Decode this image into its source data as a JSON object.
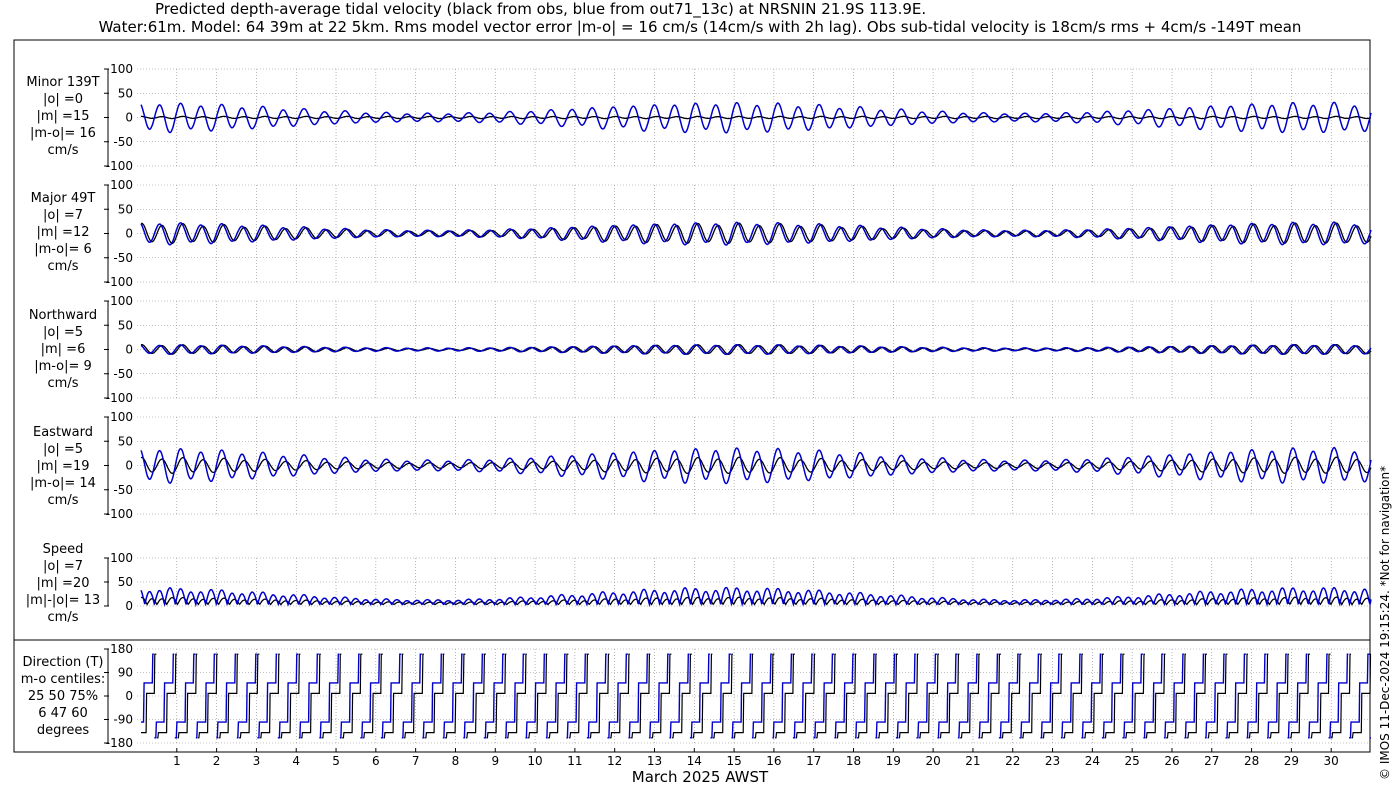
{
  "title_line1": "Predicted depth-average tidal velocity (black from obs, blue from out71_13c) at NRSNIN 21.9S 113.9E.",
  "title_line2": "Water:61m. Model: 64 39m at 22 5km. Rms model vector error |m-o| = 16 cm/s (14cm/s with 2h lag). Obs sub-tidal velocity is 18cm/s rms + 4cm/s -149T mean",
  "xlabel": "March 2025 AWST",
  "copyright": "© IMOS 11-Dec-2024 19:15:24. *Not for navigation*",
  "colors": {
    "obs": "#000000",
    "model": "#0000cc",
    "grid": "#888888"
  },
  "chart_data": {
    "type": "line",
    "x_axis": {
      "range": [
        0,
        31
      ],
      "ticks": [
        1,
        2,
        3,
        4,
        5,
        6,
        7,
        8,
        9,
        10,
        11,
        12,
        13,
        14,
        15,
        16,
        17,
        18,
        19,
        20,
        21,
        22,
        23,
        24,
        25,
        26,
        27,
        28,
        29,
        30
      ]
    },
    "series_legend": [
      "black from obs",
      "blue from out71_13c"
    ],
    "panels": [
      {
        "id": "minor",
        "label_lines": [
          "Minor 139T",
          "|o| =0",
          "|m| =15",
          "|m-o|= 16",
          "cm/s"
        ],
        "ylim": [
          -100,
          100
        ],
        "yticks": [
          100,
          50,
          0,
          -50,
          -100
        ],
        "tick_labels": [
          "100",
          "50",
          "0",
          "-50",
          "-100"
        ],
        "obs_amp": [
          2,
          2,
          2
        ],
        "model_amp": [
          28,
          8,
          28
        ]
      },
      {
        "id": "major",
        "label_lines": [
          "Major 49T",
          "|o| =7",
          "|m| =12",
          "|m-o|= 6",
          "cm/s"
        ],
        "ylim": [
          -100,
          100
        ],
        "yticks": [
          100,
          50,
          0,
          -50,
          -100
        ],
        "tick_labels": [
          "100",
          "50",
          "0",
          "-50",
          "-100"
        ],
        "obs_amp": [
          18,
          5,
          20
        ],
        "model_amp": [
          20,
          6,
          22
        ]
      },
      {
        "id": "northward",
        "label_lines": [
          "Northward",
          "|o| =5",
          "|m| =6",
          "|m-o|= 9",
          "cm/s"
        ],
        "ylim": [
          -100,
          100
        ],
        "yticks": [
          100,
          50,
          0,
          -50,
          -100
        ],
        "tick_labels": [
          "100",
          "50",
          "0",
          "-50",
          "-100"
        ],
        "obs_amp": [
          9,
          2,
          9
        ],
        "model_amp": [
          9,
          3,
          9
        ]
      },
      {
        "id": "eastward",
        "label_lines": [
          "Eastward",
          "|o| =5",
          "|m| =19",
          "|m-o|= 14",
          "cm/s"
        ],
        "ylim": [
          -100,
          100
        ],
        "yticks": [
          100,
          50,
          0,
          -50,
          -100
        ],
        "tick_labels": [
          "100",
          "50",
          "0",
          "-50",
          "-100"
        ],
        "obs_amp": [
          15,
          5,
          15
        ],
        "model_amp": [
          33,
          10,
          33
        ]
      },
      {
        "id": "speed",
        "label_lines": [
          "Speed",
          "|o| =7",
          "|m| =20",
          "|m|-|o|= 13",
          "cm/s"
        ],
        "ylim": [
          0,
          100
        ],
        "yticks": [
          100,
          50,
          0
        ],
        "tick_labels": [
          "100",
          "50",
          "0"
        ],
        "obs_amp": [
          15,
          5,
          15
        ],
        "model_amp": [
          35,
          10,
          35
        ]
      },
      {
        "id": "direction",
        "label_lines": [
          "Direction (T)",
          "m-o centiles:",
          "25  50  75%",
          "6  47  60",
          "degrees"
        ],
        "ylim": [
          -180,
          180
        ],
        "yticks": [
          180,
          90,
          0,
          -90,
          -180
        ],
        "tick_labels": [
          "180",
          "90",
          "0",
          "-90",
          "-180"
        ]
      }
    ]
  }
}
